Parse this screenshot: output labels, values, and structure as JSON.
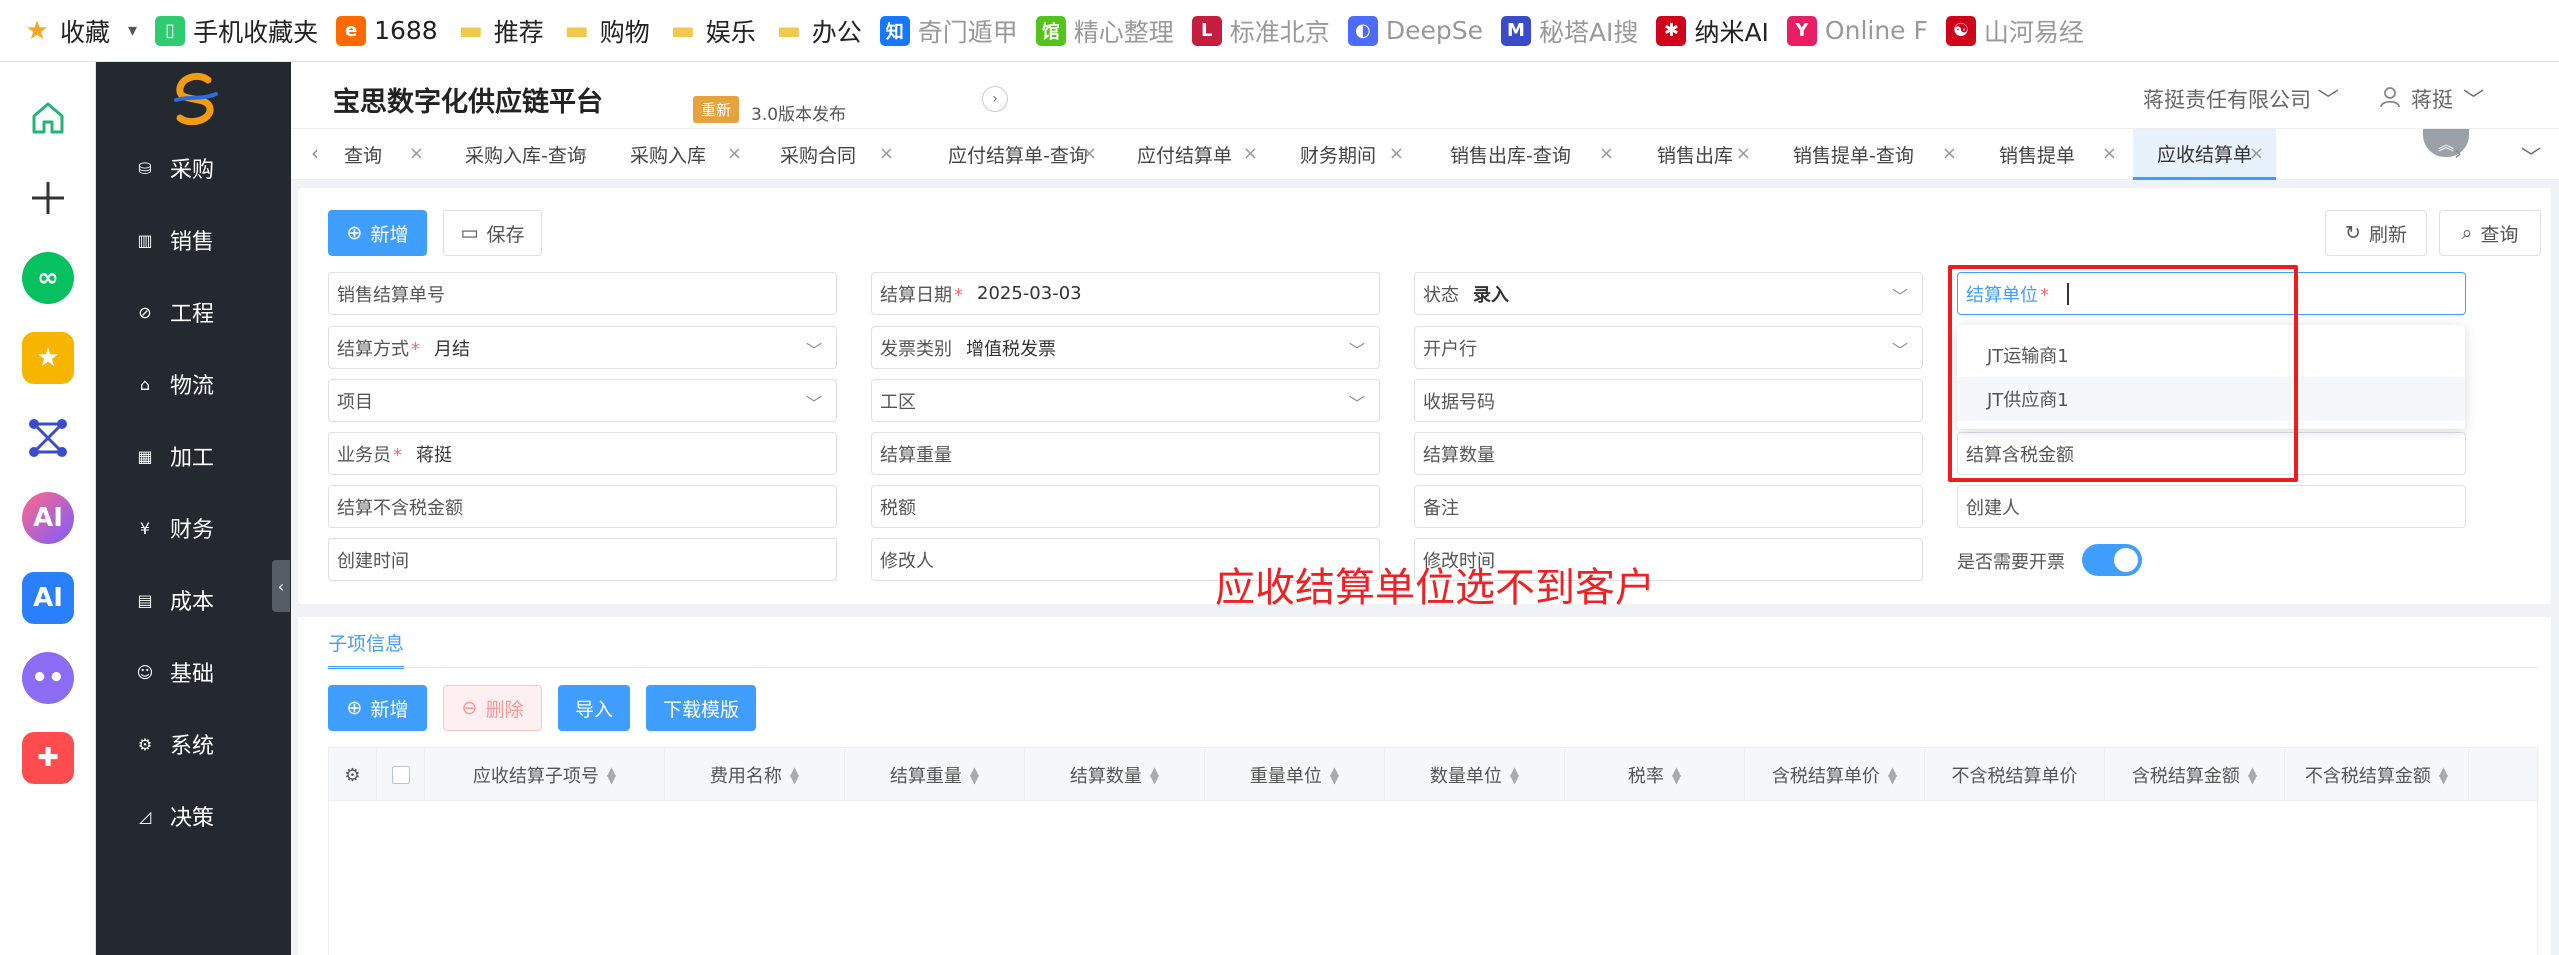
{
  "bookmarks": [
    {
      "label": "收藏",
      "icon": "star-icon",
      "color": "#f5a623"
    },
    {
      "label": "▾",
      "icon": "",
      "color": "#555"
    },
    {
      "label": "手机收藏夹",
      "icon": "phone-icon",
      "color": "#2ecc71"
    },
    {
      "label": "1688",
      "icon": "1688-logo-icon",
      "color": "#ff6a00"
    },
    {
      "label": "推荐",
      "icon": "folder-icon",
      "color": "#f2c94c"
    },
    {
      "label": "购物",
      "icon": "folder-icon",
      "color": "#f2c94c"
    },
    {
      "label": "娱乐",
      "icon": "folder-icon",
      "color": "#f2c94c"
    },
    {
      "label": "办公",
      "icon": "folder-icon",
      "color": "#f2c94c"
    },
    {
      "label": "奇门遁甲",
      "icon": "zhi-icon",
      "color": "#1677ff"
    },
    {
      "label": "精心整理",
      "icon": "guan-icon",
      "color": "#52c41a"
    },
    {
      "label": "标准北京",
      "icon": "l-icon",
      "color": "#c41d3f"
    },
    {
      "label": "DeepSe",
      "icon": "deepseek-icon",
      "color": "#4d6bfe"
    },
    {
      "label": "秘塔AI搜",
      "icon": "metaso-icon",
      "color": "#3b4cca"
    },
    {
      "label": "纳米AI",
      "icon": "nami-icon",
      "color": "#d0021b"
    },
    {
      "label": "Online F",
      "icon": "y-icon",
      "color": "#e91e63"
    },
    {
      "label": "山河易经",
      "icon": "taiji-icon",
      "color": "#d0021b"
    }
  ],
  "menu": [
    "采购",
    "销售",
    "工程",
    "物流",
    "加工",
    "财务",
    "成本",
    "基础",
    "系统",
    "决策"
  ],
  "header": {
    "title": "宝思数字化供应链平台",
    "release_tag": "重新",
    "release_text": "3.0版本发布",
    "company": "蒋挺责任有限公司",
    "user": "蒋挺"
  },
  "tabs": [
    "查询",
    "采购入库-查询",
    "采购入库",
    "采购合同",
    "应付结算单-查询",
    "应付结算单",
    "财务期间",
    "销售出库-查询",
    "销售出库",
    "销售提单-查询",
    "销售提单",
    "应收结算单"
  ],
  "toolbar": {
    "new": "新增",
    "save": "保存",
    "refresh": "刷新",
    "query": "查询"
  },
  "form": {
    "sale_settle_no": {
      "label": "销售结算单号",
      "value": ""
    },
    "settle_date": {
      "label": "结算日期",
      "value": "2025-03-03"
    },
    "status": {
      "label": "状态",
      "value": "录入"
    },
    "settle_unit": {
      "label": "结算单位",
      "value": ""
    },
    "settle_method": {
      "label": "结算方式",
      "value": "月结"
    },
    "invoice_type": {
      "label": "发票类别",
      "value": "增值税发票"
    },
    "bank": {
      "label": "开户行",
      "value": ""
    },
    "project": {
      "label": "项目",
      "value": ""
    },
    "work_area": {
      "label": "工区",
      "value": ""
    },
    "receipt_no": {
      "label": "收据号码",
      "value": ""
    },
    "salesman": {
      "label": "业务员",
      "value": "蒋挺"
    },
    "settle_weight": {
      "label": "结算重量",
      "value": ""
    },
    "settle_qty": {
      "label": "结算数量",
      "value": ""
    },
    "settle_amount_tax": {
      "label": "结算含税金额",
      "value": ""
    },
    "settle_amount_notax": {
      "label": "结算不含税金额",
      "value": ""
    },
    "tax": {
      "label": "税额",
      "value": ""
    },
    "remark": {
      "label": "备注",
      "value": ""
    },
    "creator": {
      "label": "创建人",
      "value": ""
    },
    "created_at": {
      "label": "创建时间",
      "value": ""
    },
    "modifier": {
      "label": "修改人",
      "value": ""
    },
    "modified_at": {
      "label": "修改时间",
      "value": ""
    },
    "need_invoice": {
      "label": "是否需要开票",
      "value": true
    }
  },
  "dropdown": [
    "JT运输商1",
    "JT供应商1"
  ],
  "annotation": "应收结算单位选不到客户",
  "sub": {
    "tab": "子项信息",
    "buttons": {
      "new": "新增",
      "delete": "删除",
      "import": "导入",
      "template": "下载模版"
    },
    "columns": [
      "应收结算子项号",
      "费用名称",
      "结算重量",
      "结算数量",
      "重量单位",
      "数量单位",
      "税率",
      "含税结算单价",
      "不含税结算单价",
      "含税结算金额",
      "不含税结算金额"
    ]
  },
  "colors": {
    "primary": "#409eff",
    "annotation": "#ee1c1c",
    "sidebar": "#23292f"
  }
}
